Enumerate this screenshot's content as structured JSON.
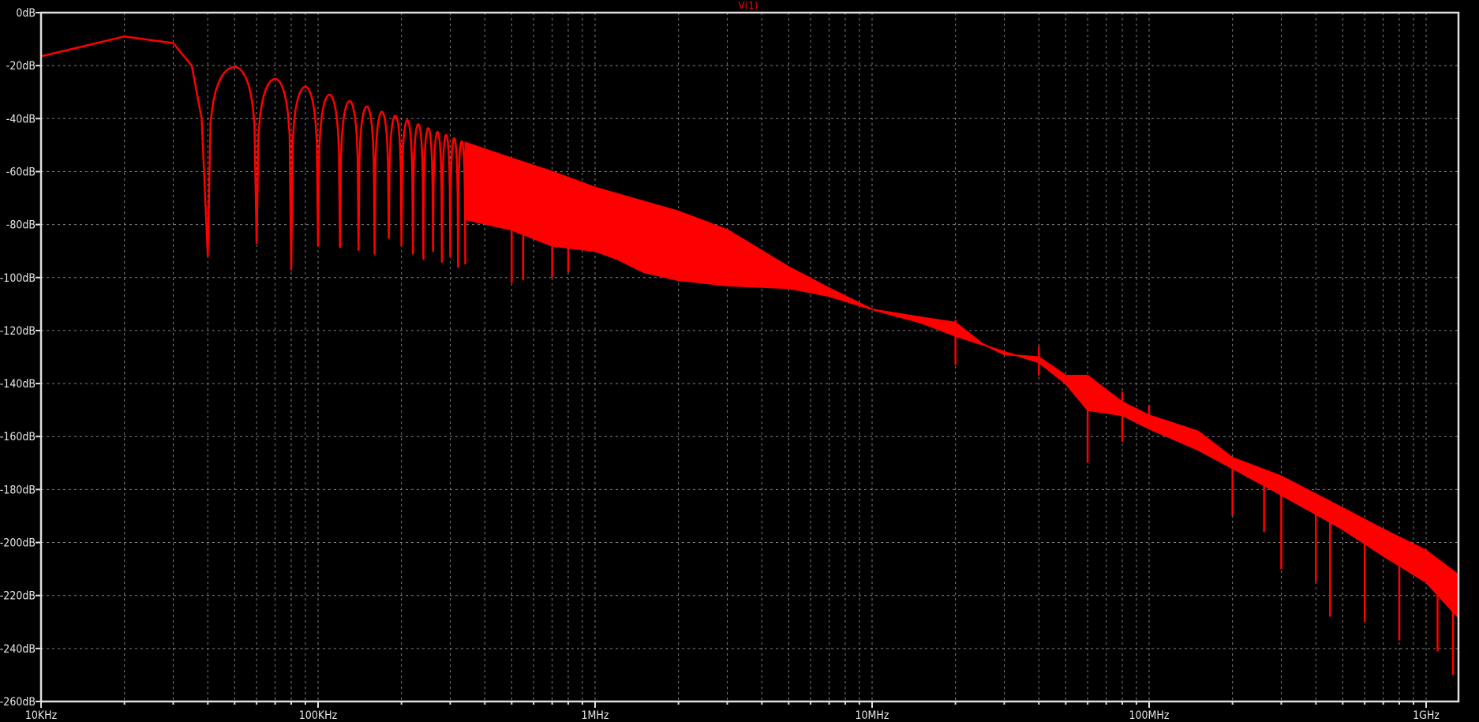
{
  "chart_data": {
    "type": "line",
    "title": "V(1)",
    "xlabel": "",
    "ylabel": "",
    "x_scale": "log",
    "xlim_hz": [
      10000,
      1300000000
    ],
    "ylim_db": [
      -260,
      0
    ],
    "grid": true,
    "trace_color": "#ff0000",
    "background_color": "#000000",
    "axis_color": "#e0e0e0",
    "grid_color": "#808080",
    "x_ticks": [
      {
        "hz": 10000,
        "label": "10KHz"
      },
      {
        "hz": 100000,
        "label": "100KHz"
      },
      {
        "hz": 1000000,
        "label": "1MHz"
      },
      {
        "hz": 10000000,
        "label": "10MHz"
      },
      {
        "hz": 100000000,
        "label": "100MHz"
      },
      {
        "hz": 1000000000,
        "label": "1GHz"
      }
    ],
    "y_ticks": [
      {
        "db": 0,
        "label": "0dB"
      },
      {
        "db": -20,
        "label": "-20dB"
      },
      {
        "db": -40,
        "label": "-40dB"
      },
      {
        "db": -60,
        "label": "-60dB"
      },
      {
        "db": -80,
        "label": "-80dB"
      },
      {
        "db": -100,
        "label": "-100dB"
      },
      {
        "db": -120,
        "label": "-120dB"
      },
      {
        "db": -140,
        "label": "-140dB"
      },
      {
        "db": -160,
        "label": "-160dB"
      },
      {
        "db": -180,
        "label": "-180dB"
      },
      {
        "db": -200,
        "label": "-200dB"
      },
      {
        "db": -220,
        "label": "-220dB"
      },
      {
        "db": -240,
        "label": "-240dB"
      },
      {
        "db": -260,
        "label": "-260dB"
      }
    ],
    "series": [
      {
        "name": "V(1)",
        "main_lobe": [
          [
            10000,
            -16.5
          ],
          [
            20000,
            -9
          ],
          [
            30000,
            -11.5
          ],
          [
            35000,
            -20
          ],
          [
            38000,
            -40
          ],
          [
            40000,
            -92
          ]
        ],
        "lobes": [
          {
            "peak_hz": 50000,
            "peak_db": -20.5,
            "notch_hz": 60000,
            "notch_db": -87
          },
          {
            "peak_hz": 70000,
            "peak_db": -25,
            "notch_hz": 80000,
            "notch_db": -97
          },
          {
            "peak_hz": 90000,
            "peak_db": -28,
            "notch_hz": 100000,
            "notch_db": -88
          },
          {
            "peak_hz": 110000,
            "peak_db": -31,
            "notch_hz": 120000,
            "notch_db": -88.5
          },
          {
            "peak_hz": 130000,
            "peak_db": -33.4,
            "notch_hz": 140000,
            "notch_db": -89.6
          },
          {
            "peak_hz": 150000,
            "peak_db": -35.4,
            "notch_hz": 160000,
            "notch_db": -91
          },
          {
            "peak_hz": 170000,
            "peak_db": -37.4,
            "notch_hz": 180000,
            "notch_db": -85
          },
          {
            "peak_hz": 190000,
            "peak_db": -38.9,
            "notch_hz": 200000,
            "notch_db": -88
          },
          {
            "peak_hz": 210000,
            "peak_db": -40.6,
            "notch_hz": 220000,
            "notch_db": -91
          },
          {
            "peak_hz": 230000,
            "peak_db": -42.1,
            "notch_hz": 240000,
            "notch_db": -93
          },
          {
            "peak_hz": 250000,
            "peak_db": -43.6,
            "notch_hz": 260000,
            "notch_db": -90
          },
          {
            "peak_hz": 270000,
            "peak_db": -45,
            "notch_hz": 280000,
            "notch_db": -94
          },
          {
            "peak_hz": 290000,
            "peak_db": -46.1,
            "notch_hz": 300000,
            "notch_db": -92
          },
          {
            "peak_hz": 310000,
            "peak_db": -47.4,
            "notch_hz": 320000,
            "notch_db": -96
          },
          {
            "peak_hz": 330000,
            "peak_db": -48.6,
            "notch_hz": 340000,
            "notch_db": -95
          }
        ],
        "upper_envelope": [
          [
            340000,
            -49
          ],
          [
            500000,
            -55
          ],
          [
            700000,
            -60
          ],
          [
            1000000,
            -66
          ],
          [
            2000000,
            -75
          ],
          [
            3000000,
            -82
          ],
          [
            5000000,
            -96
          ],
          [
            7000000,
            -104
          ],
          [
            10000000,
            -112
          ],
          [
            15000000,
            -115
          ],
          [
            20000000,
            -117
          ],
          [
            25000000,
            -125
          ],
          [
            30000000,
            -129
          ],
          [
            40000000,
            -130
          ],
          [
            50000000,
            -137
          ],
          [
            60000000,
            -137
          ],
          [
            80000000,
            -147
          ],
          [
            100000000,
            -152
          ],
          [
            150000000,
            -158
          ],
          [
            200000000,
            -168
          ],
          [
            300000000,
            -175
          ],
          [
            500000000,
            -187
          ],
          [
            700000000,
            -195
          ],
          [
            1000000000,
            -203
          ],
          [
            1300000000,
            -212
          ]
        ],
        "lower_envelope": [
          [
            340000,
            -78
          ],
          [
            500000,
            -82
          ],
          [
            700000,
            -88
          ],
          [
            1000000,
            -90
          ],
          [
            1200000,
            -93
          ],
          [
            1500000,
            -98
          ],
          [
            2000000,
            -101
          ],
          [
            3000000,
            -103
          ],
          [
            5000000,
            -104
          ],
          [
            7000000,
            -107
          ],
          [
            10000000,
            -112
          ],
          [
            15000000,
            -117
          ],
          [
            20000000,
            -122
          ],
          [
            30000000,
            -128
          ],
          [
            40000000,
            -132
          ],
          [
            50000000,
            -140
          ],
          [
            60000000,
            -150
          ],
          [
            80000000,
            -152
          ],
          [
            100000000,
            -157
          ],
          [
            150000000,
            -165
          ],
          [
            200000000,
            -172
          ],
          [
            300000000,
            -182
          ],
          [
            500000000,
            -195
          ],
          [
            700000000,
            -205
          ],
          [
            1000000000,
            -215
          ],
          [
            1300000000,
            -228
          ]
        ],
        "spikes_down": [
          [
            500000,
            -102
          ],
          [
            550000,
            -101
          ],
          [
            700000,
            -100
          ],
          [
            800000,
            -98
          ],
          [
            20000000,
            -133
          ],
          [
            40000000,
            -137
          ],
          [
            60000000,
            -170
          ],
          [
            80000000,
            -162
          ],
          [
            140000000,
            -161
          ],
          [
            200000000,
            -190
          ],
          [
            260000000,
            -196
          ],
          [
            300000000,
            -210
          ],
          [
            400000000,
            -215
          ],
          [
            450000000,
            -228
          ],
          [
            600000000,
            -230
          ],
          [
            800000000,
            -237
          ],
          [
            1100000000,
            -241
          ],
          [
            1250000000,
            -250
          ]
        ],
        "spikes_up": [
          [
            20000000,
            -116
          ],
          [
            40000000,
            -126
          ],
          [
            80000000,
            -143
          ],
          [
            100000000,
            -148
          ]
        ]
      }
    ]
  }
}
